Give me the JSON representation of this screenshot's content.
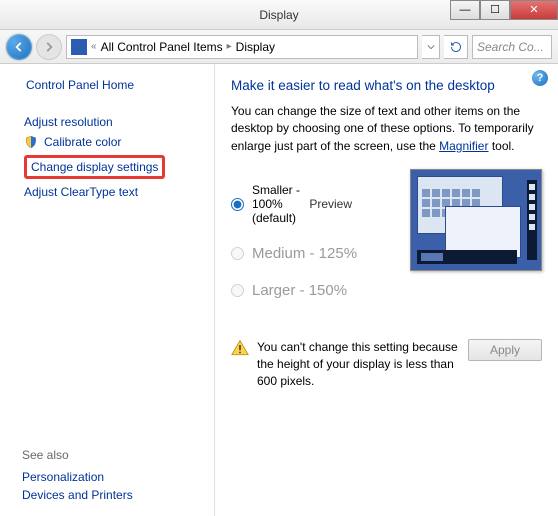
{
  "window": {
    "title": "Display"
  },
  "nav": {
    "breadcrumb": [
      "All Control Panel Items",
      "Display"
    ],
    "search_placeholder": "Search Co..."
  },
  "sidebar": {
    "home": "Control Panel Home",
    "tasks": [
      {
        "label": "Adjust resolution",
        "shield": false
      },
      {
        "label": "Calibrate color",
        "shield": true
      },
      {
        "label": "Change display settings",
        "shield": false,
        "highlight": true
      },
      {
        "label": "Adjust ClearType text",
        "shield": false
      }
    ],
    "seealso_heading": "See also",
    "seealso": [
      "Personalization",
      "Devices and Printers"
    ]
  },
  "main": {
    "heading": "Make it easier to read what's on the desktop",
    "description_pre": "You can change the size of text and other items on the desktop by choosing one of these options. To temporarily enlarge just part of the screen, use the ",
    "description_link": "Magnifier",
    "description_post": " tool.",
    "options": [
      {
        "label": "Smaller - 100% (default)",
        "checked": true,
        "disabled": false
      },
      {
        "label": "Medium - 125%",
        "checked": false,
        "disabled": true
      },
      {
        "label": "Larger - 150%",
        "checked": false,
        "disabled": true
      }
    ],
    "preview_label": "Preview",
    "warning": "You can't change this setting because the height of your display is less than 600 pixels.",
    "apply_label": "Apply"
  }
}
